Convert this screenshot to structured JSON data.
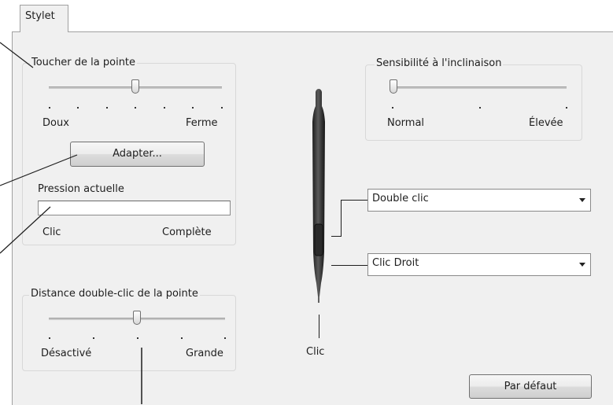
{
  "tab": {
    "label": "Stylet"
  },
  "tip_feel": {
    "legend": "Toucher de la pointe",
    "min_label": "Doux",
    "max_label": "Ferme",
    "customize_button": "Adapter...",
    "current_pressure_label": "Pression actuelle",
    "pressure_min_label": "Clic",
    "pressure_max_label": "Complète",
    "slider_level": 0.5,
    "pressure_level": 0
  },
  "tilt": {
    "legend": "Sensibilité à l'inclinaison",
    "min_label": "Normal",
    "max_label": "Élevée",
    "slider_level": 0
  },
  "double_click": {
    "legend": "Distance double-clic de la pointe",
    "min_label": "Désactivé",
    "max_label": "Grande",
    "slider_level": 0.5
  },
  "buttons": {
    "upper": "Double clic",
    "lower": "Clic Droit"
  },
  "pen_tip_label": "Clic",
  "default_button": "Par défaut"
}
